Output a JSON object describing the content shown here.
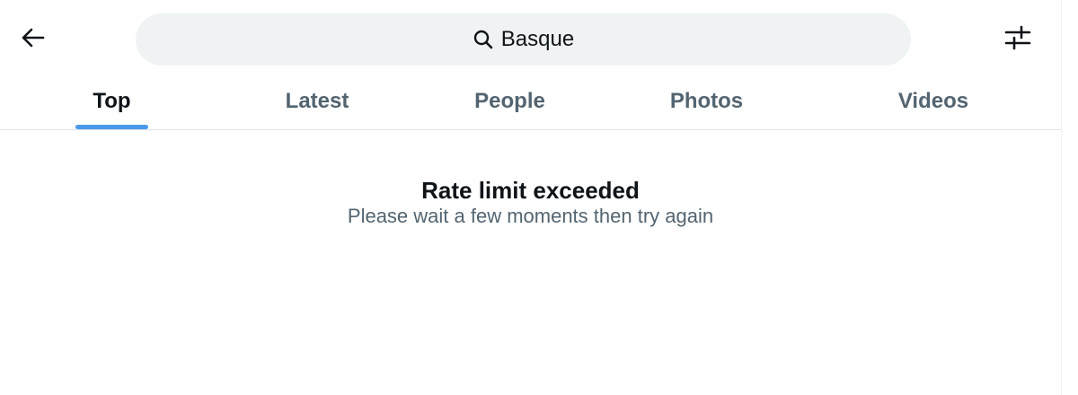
{
  "header": {
    "search_value": "Basque",
    "back_icon": "arrow-left-icon",
    "search_icon": "search-icon",
    "filter_icon": "sliders-icon"
  },
  "tabs": [
    {
      "label": "Top",
      "active": true
    },
    {
      "label": "Latest",
      "active": false
    },
    {
      "label": "People",
      "active": false
    },
    {
      "label": "Photos",
      "active": false
    },
    {
      "label": "Videos",
      "active": false
    }
  ],
  "message": {
    "title": "Rate limit exceeded",
    "subtitle": "Please wait a few moments then try again"
  },
  "colors": {
    "accent": "#4a99e9",
    "text_primary": "#0f1419",
    "text_secondary": "#536471",
    "search_bg": "#eff3f4"
  }
}
